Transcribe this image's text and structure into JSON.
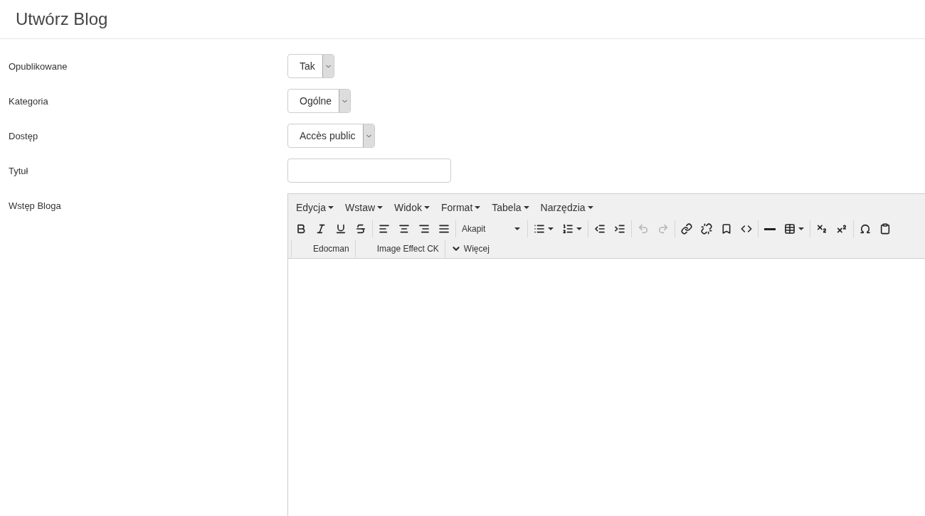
{
  "page_title": "Utwórz Blog",
  "fields": [
    {
      "label": "Opublikowane",
      "kind": "select",
      "value": "Tak"
    },
    {
      "label": "Kategoria",
      "kind": "select",
      "value": "Ogólne"
    },
    {
      "label": "Dostęp",
      "kind": "select",
      "value": "Accès public"
    },
    {
      "label": "Tytuł",
      "kind": "text"
    },
    {
      "label": "Wstęp Bloga",
      "kind": "editor"
    }
  ],
  "editor": {
    "menus": [
      "Edycja",
      "Wstaw",
      "Widok",
      "Format",
      "Tabela",
      "Narzędzia"
    ],
    "toolbar": [
      {
        "kind": "button",
        "disabled": false,
        "dropdown": false
      },
      {
        "kind": "button",
        "disabled": false,
        "dropdown": false
      },
      {
        "kind": "button",
        "disabled": false,
        "dropdown": false
      },
      {
        "kind": "button",
        "disabled": false,
        "dropdown": false
      },
      {
        "kind": "separator"
      },
      {
        "kind": "button",
        "disabled": false,
        "dropdown": false
      },
      {
        "kind": "button",
        "disabled": false,
        "dropdown": false
      },
      {
        "kind": "button",
        "disabled": false,
        "dropdown": false
      },
      {
        "kind": "button",
        "disabled": false,
        "dropdown": false
      },
      {
        "kind": "separator"
      },
      {
        "kind": "select",
        "value": "Akapit"
      },
      {
        "kind": "separator"
      },
      {
        "kind": "button",
        "disabled": false,
        "dropdown": true
      },
      {
        "kind": "button",
        "disabled": false,
        "dropdown": true
      },
      {
        "kind": "separator"
      },
      {
        "kind": "button",
        "disabled": false,
        "dropdown": false
      },
      {
        "kind": "button",
        "disabled": false,
        "dropdown": false
      },
      {
        "kind": "separator"
      },
      {
        "kind": "button",
        "disabled": true,
        "dropdown": false
      },
      {
        "kind": "button",
        "disabled": true,
        "dropdown": false
      },
      {
        "kind": "separator"
      },
      {
        "kind": "button",
        "disabled": false,
        "dropdown": false
      },
      {
        "kind": "button",
        "disabled": false,
        "dropdown": false
      },
      {
        "kind": "button",
        "disabled": false,
        "dropdown": false
      },
      {
        "kind": "button",
        "disabled": false,
        "dropdown": false
      },
      {
        "kind": "separator"
      },
      {
        "kind": "button",
        "disabled": false,
        "dropdown": false
      },
      {
        "kind": "button",
        "disabled": false,
        "dropdown": true
      },
      {
        "kind": "separator"
      },
      {
        "kind": "button",
        "disabled": false,
        "dropdown": false
      },
      {
        "kind": "button",
        "disabled": false,
        "dropdown": false
      },
      {
        "kind": "separator"
      },
      {
        "kind": "button",
        "disabled": false,
        "dropdown": false
      },
      {
        "kind": "button",
        "disabled": false,
        "dropdown": false
      }
    ],
    "plugins": [
      {
        "kind": "plain",
        "label": "Edocman"
      },
      {
        "kind": "plain",
        "label": "Image Effect CK"
      },
      {
        "kind": "more",
        "label": "Więcej"
      }
    ]
  }
}
